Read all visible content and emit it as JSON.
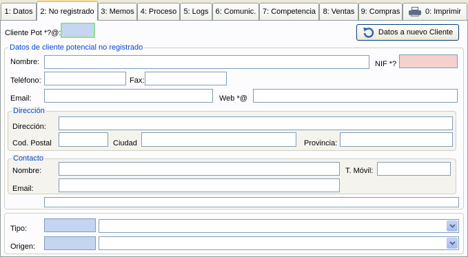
{
  "tabs": [
    {
      "label": "1: Datos"
    },
    {
      "label": "2: No registrado"
    },
    {
      "label": "3: Memos"
    },
    {
      "label": "4: Proceso"
    },
    {
      "label": "5: Logs"
    },
    {
      "label": "6: Comunic."
    },
    {
      "label": "7: Competencia"
    },
    {
      "label": "8: Ventas"
    },
    {
      "label": "9: Compras"
    },
    {
      "label": "0: Imprimir"
    }
  ],
  "header": {
    "cliente_pot_label": "Cliente Pot *?@:",
    "cliente_pot_value": "",
    "nuevo_cliente_button": "Datos a nuevo Cliente"
  },
  "datos": {
    "legend": "Datos de cliente potencial no registrado",
    "nombre_label": "Nombre:",
    "nif_label": "NIF *?",
    "telefono_label": "Teléfono:",
    "fax_label": "Fax:",
    "email_label": "Email:",
    "web_label": "Web *@"
  },
  "direccion": {
    "legend": "Dirección",
    "direccion_label": "Dirección:",
    "cod_postal_label": "Cod. Postal",
    "ciudad_label": "Ciudad",
    "provincia_label": "Provincia:"
  },
  "contacto": {
    "legend": "Contacto",
    "nombre_label": "Nombre:",
    "movil_label": "T. Móvil:",
    "email_label": "Email:"
  },
  "bottom": {
    "tipo_label": "Tipo:",
    "origen_label": "Origen:"
  }
}
